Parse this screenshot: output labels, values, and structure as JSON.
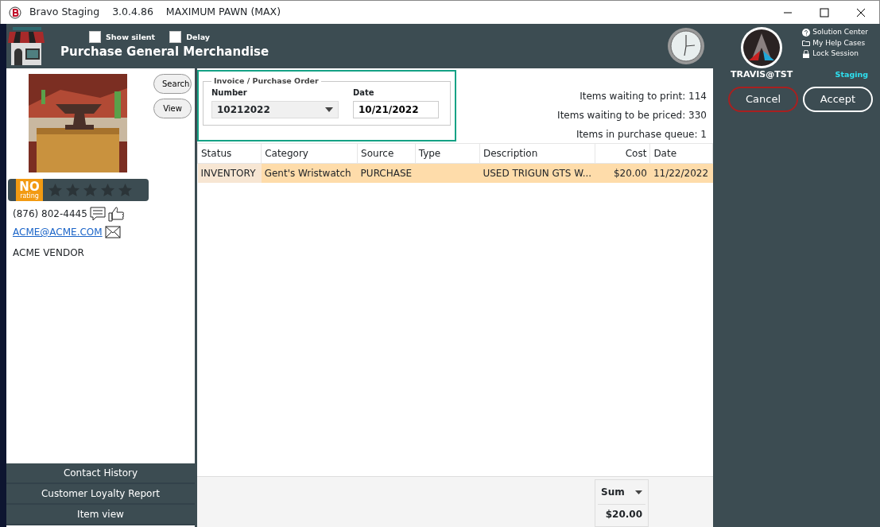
{
  "window": {
    "app": "Bravo Staging",
    "version": "3.0.4.86",
    "store": "MAXIMUM PAWN (MAX)"
  },
  "header": {
    "title": "Purchase General Merchandise",
    "options": [
      {
        "label": "Show silent",
        "checked": false
      },
      {
        "label": "Delay",
        "checked": false
      }
    ]
  },
  "help_links": [
    {
      "kind": "help",
      "label": "Solution Center"
    },
    {
      "kind": "folder",
      "label": "My Help Cases"
    },
    {
      "kind": "lock",
      "label": "Lock Session"
    }
  ],
  "user": {
    "name": "TRAVIS@TST",
    "environment": "Staging"
  },
  "actions": [
    {
      "label": "Cancel",
      "kind": "cancel"
    },
    {
      "label": "Accept",
      "kind": "accept"
    }
  ],
  "vendor": {
    "buttons": [
      "Search",
      "View"
    ],
    "rating_badge": "NO",
    "rating_caption": "rating",
    "stars": 0,
    "phone": "(876) 802-4445",
    "email": "ACME@ACME.COM",
    "name": "ACME VENDOR"
  },
  "side_buttons": [
    "Contact History",
    "Customer Loyalty Report",
    "Item view"
  ],
  "invoice": {
    "legend": "Invoice / Purchase Order",
    "number_label": "Number",
    "number": "10212022",
    "date_label": "Date",
    "date": "10/21/2022"
  },
  "queue_info": [
    "Items waiting to print: 114",
    "Items waiting to be priced: 330",
    "Items in purchase queue: 1"
  ],
  "table": {
    "columns": [
      "Status",
      "Category",
      "Source",
      "Type",
      "Description",
      "Cost",
      "Date"
    ],
    "rows": [
      {
        "cells": [
          "INVENTORY",
          "Gent's Wristwatch",
          "PURCHASE",
          "",
          "USED TRIGUN GTS W...",
          "$20.00",
          "11/22/2022"
        ],
        "selected": true
      }
    ]
  },
  "summary": {
    "function": "Sum",
    "value": "$20.00"
  }
}
